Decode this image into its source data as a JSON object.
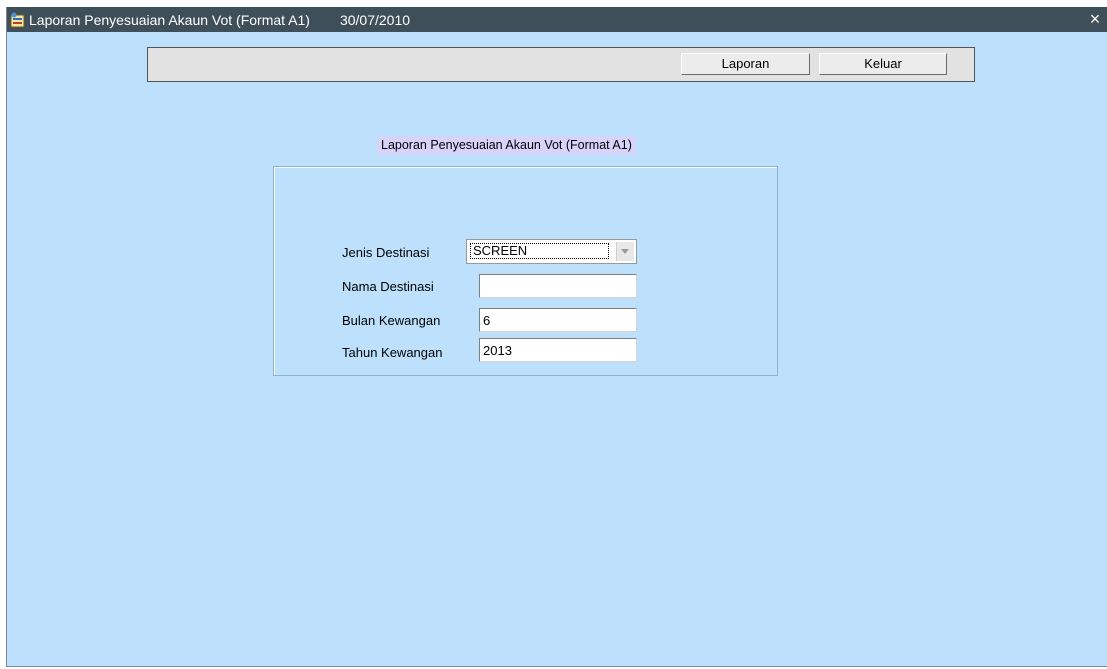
{
  "window": {
    "title": "Laporan Penyesuaian Akaun Vot (Format A1)",
    "date": "30/07/2010",
    "close_glyph": "×",
    "icon": "app-form-icon"
  },
  "toolbar": {
    "laporan_label": "Laporan",
    "keluar_label": "Keluar"
  },
  "form": {
    "section_title": "Laporan Penyesuaian Akaun Vot (Format A1)",
    "fields": [
      {
        "label": "Jenis Destinasi",
        "value": "SCREEN",
        "type": "select"
      },
      {
        "label": "Nama Destinasi",
        "value": "",
        "type": "text"
      },
      {
        "label": "Bulan Kewangan",
        "value": "6",
        "type": "text"
      },
      {
        "label": "Tahun Kewangan",
        "value": "2013",
        "type": "text"
      }
    ]
  },
  "colors": {
    "background": "#bde0fc",
    "titlebar": "#3f4f59",
    "section_title_bg": "#d7d3fb"
  }
}
